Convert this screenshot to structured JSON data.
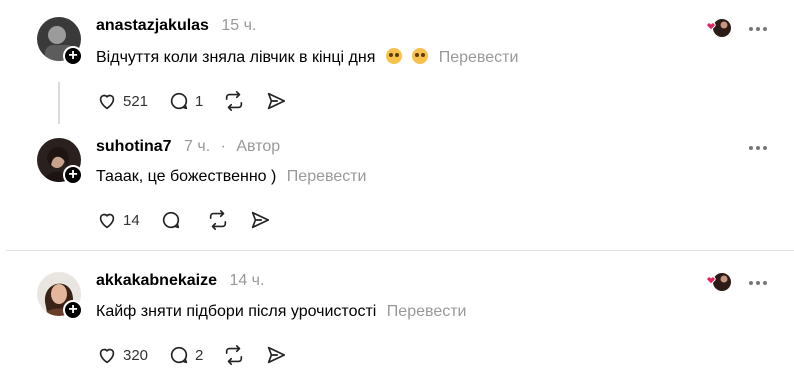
{
  "posts": [
    {
      "username": "anastazjakulas",
      "time": "15 ч.",
      "author_tag": "",
      "text": "Відчуття коли зняла лівчик в кінці дня",
      "emojis": [
        "pleading-face",
        "pleading-face"
      ],
      "translate": "Перевести",
      "likes": "521",
      "replies": "1",
      "has_likers": true
    },
    {
      "username": "suhotina7",
      "time": "7 ч.",
      "author_tag": "Автор",
      "text": "Тааак, це божественно )",
      "emojis": [],
      "translate": "Перевести",
      "likes": "14",
      "replies": "",
      "has_likers": false
    },
    {
      "username": "akkakabnekaize",
      "time": "14 ч.",
      "author_tag": "",
      "text": "Кайф зняти підбори після урочистості",
      "emojis": [],
      "translate": "Перевести",
      "likes": "320",
      "replies": "2",
      "has_likers": true
    }
  ],
  "separator": "·",
  "colors": {
    "meta_gray": "#999999",
    "like_heart": "#e0245e"
  },
  "icons": [
    "heart-icon",
    "comment-icon",
    "repost-icon",
    "share-icon",
    "more-icon",
    "follow-plus-icon"
  ]
}
